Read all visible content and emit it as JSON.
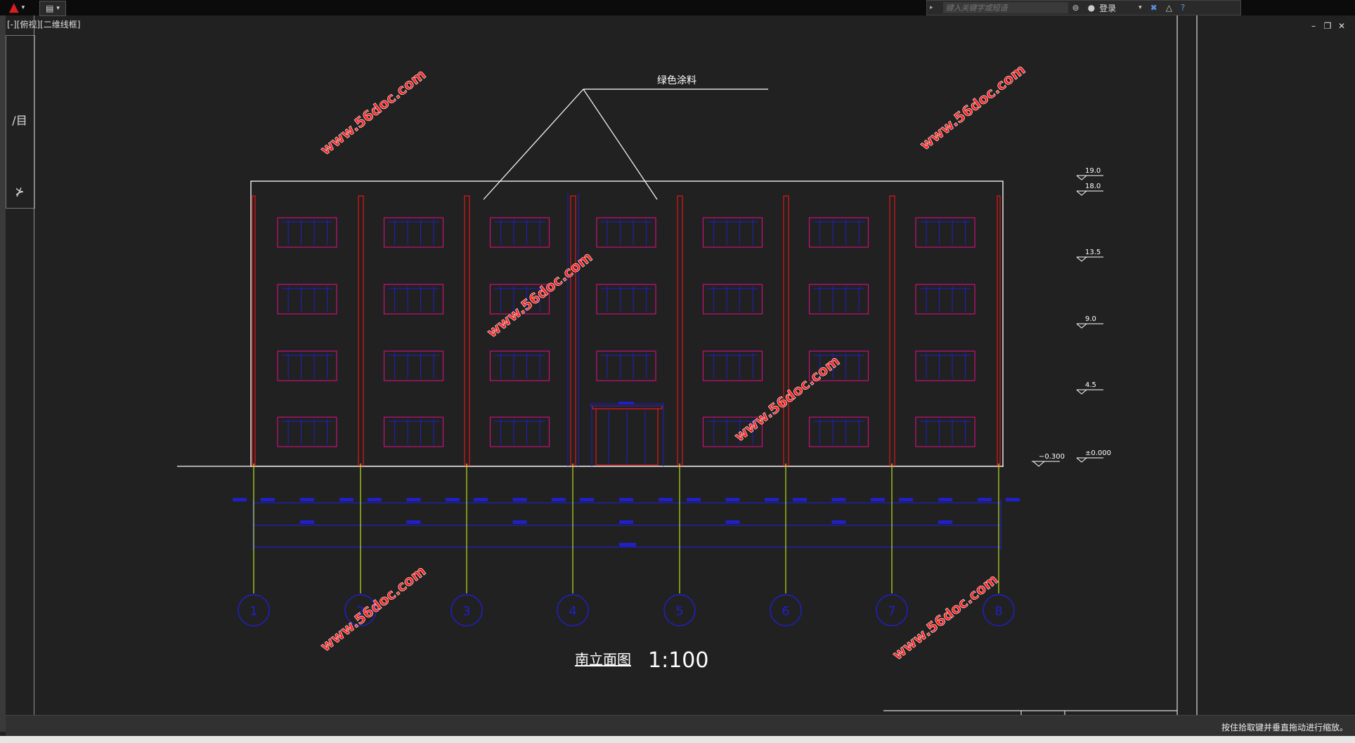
{
  "app": {
    "menu_icon": "autocad-logo-icon",
    "quick_access_icon": "save-icon",
    "viewport_label": "[-][俯视][二维线框]"
  },
  "search": {
    "placeholder": "键入关键字或短语",
    "sign_in_label": "登录",
    "binoculars_icon": "binoculars-icon",
    "user_icon": "user-icon",
    "exchange_icon": "exchange-icon",
    "help_icon": "help-icon"
  },
  "window_controls": {
    "minimize": "–",
    "restore": "❐",
    "close": "✕"
  },
  "tools": {
    "tool1_label": "/目",
    "tool2_label": "⊁"
  },
  "drawing": {
    "material_note": "绿色涂料",
    "title": "南立面图",
    "scale": "1:100",
    "levels": [
      "19.0",
      "18.0",
      "13.5",
      "9.0",
      "4.5",
      "±0.000"
    ],
    "ground_level": "−0.300",
    "axes": [
      "1",
      "2",
      "3",
      "4",
      "5",
      "6",
      "7",
      "8"
    ],
    "watermark": "www.56doc.com"
  },
  "status": {
    "message": "按住拾取键并垂直拖动进行缩放。"
  },
  "colors": {
    "background": "#212121",
    "building_outline": "#ffffff",
    "columns": "#e01818",
    "windows": "#c8107a",
    "dimensions": "#2020c8",
    "axis_lines": "#b8e020",
    "watermark": "#ff2020"
  }
}
